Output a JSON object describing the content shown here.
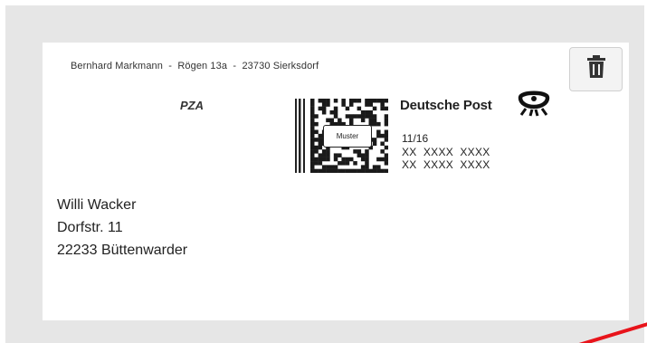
{
  "envelope": {
    "sender_line": "Bernhard Markmann  -  Rögen 13a  -  23730 Sierksdorf",
    "delete_icon": "trash-icon",
    "product_code": "PZA",
    "stamp": {
      "brand": "Deutsche Post",
      "brand_icon": "post-horn-icon",
      "sample_label": "Muster",
      "date": "11/16",
      "code_line_1": "XX  XXXX  XXXX",
      "code_line_2": "XX  XXXX  XXXX"
    },
    "recipient": {
      "name": "Willi Wacker",
      "street": "Dorfstr. 11",
      "city": "22233 Büttenwarder"
    }
  },
  "colors": {
    "background": "#e6e6e6",
    "card": "#ffffff",
    "text": "#222222",
    "accent_line": "#e8141b"
  }
}
